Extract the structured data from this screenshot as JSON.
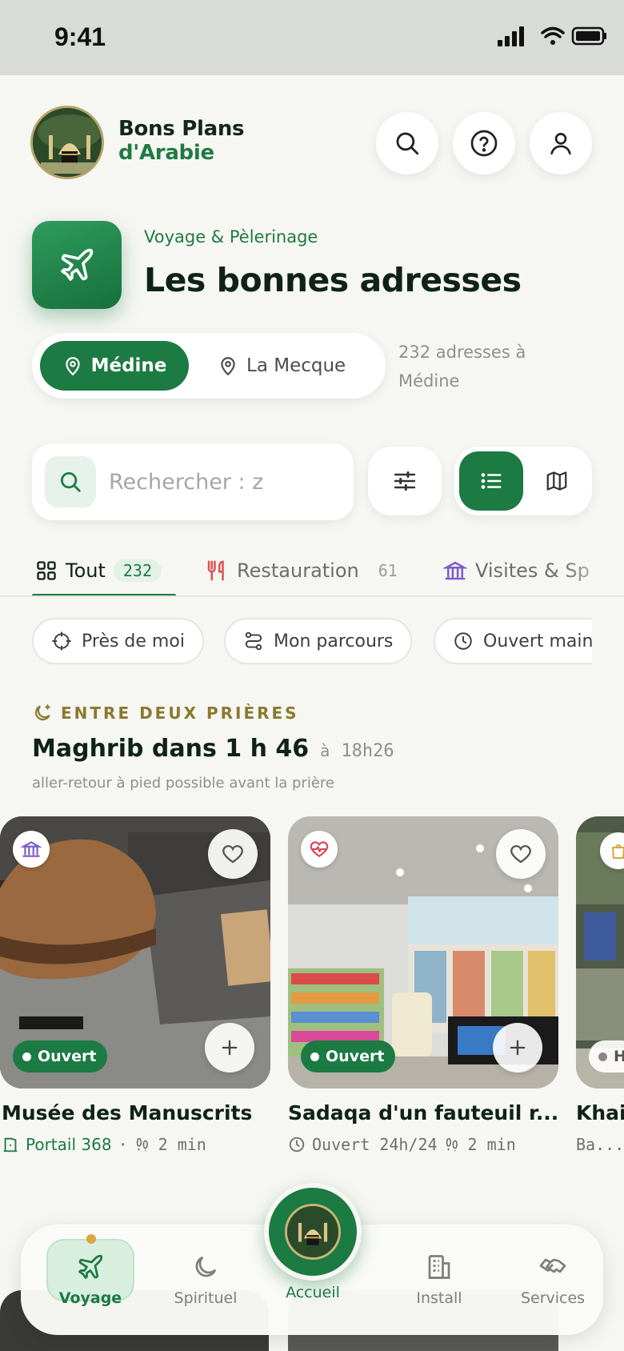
{
  "status_bar": {
    "time": "9:41"
  },
  "header": {
    "brand_line1": "Bons Plans",
    "brand_line2": "d'Arabie"
  },
  "hero": {
    "kicker": "Voyage & Pèlerinage",
    "title": "Les bonnes adresses"
  },
  "cities": {
    "active": "Médine",
    "other": "La Mecque",
    "count_text": "232 adresses à Médine"
  },
  "search": {
    "placeholder": "Rechercher : z"
  },
  "tabs": [
    {
      "label": "Tout",
      "count": "232"
    },
    {
      "label": "Restauration",
      "count": "61"
    },
    {
      "label": "Visites & Sp",
      "count": ""
    }
  ],
  "chips": [
    "Près de moi",
    "Mon parcours",
    "Ouvert main"
  ],
  "section": {
    "kicker": "ENTRE DEUX PRIÈRES",
    "title": "Maghrib dans 1 h 46",
    "at": "à",
    "time": "18h26",
    "subtitle": "aller-retour à pied possible avant la prière"
  },
  "cards": [
    {
      "title": "Musée des Manuscrits",
      "status": "Ouvert",
      "meta_gate": "Portail 368",
      "meta_walk": "2 min",
      "category_icon": "museum-icon"
    },
    {
      "title": "Sadaqa d'un fauteuil r...",
      "status": "Ouvert",
      "meta_hours": "Ouvert 24h/24",
      "meta_walk": "2 min",
      "category_icon": "heart-pulse-icon"
    },
    {
      "title": "Khai",
      "status": "H",
      "meta_short": "Ba...",
      "category_icon": "shopping-bag-icon"
    }
  ],
  "nav": {
    "voyage": "Voyage",
    "spirituel": "Spirituel",
    "accueil": "Accueil",
    "install": "Install",
    "services": "Services"
  },
  "colors": {
    "brand_green": "#1c7a43",
    "accent_gold": "#8a7a2c",
    "background": "#f6f6f3"
  }
}
